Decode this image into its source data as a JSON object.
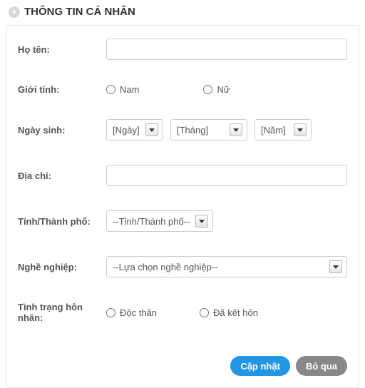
{
  "header": {
    "title": "THÔNG TIN CÁ NHÂN"
  },
  "form": {
    "fullname": {
      "label": "Họ tên:",
      "value": ""
    },
    "gender": {
      "label": "Giới tính:",
      "options": {
        "male": "Nam",
        "female": "Nữ"
      }
    },
    "dob": {
      "label": "Ngày sinh:",
      "day": "[Ngày]",
      "month": "[Tháng]",
      "year": "[Năm]"
    },
    "address": {
      "label": "Địa chỉ:",
      "value": ""
    },
    "province": {
      "label": "Tỉnh/Thành phố:",
      "selected": "--Tỉnh/Thành phố--"
    },
    "occupation": {
      "label": "Nghề nghiệp:",
      "selected": "--Lựa chọn nghề nghiệp--"
    },
    "marital": {
      "label": "Tình trạng hôn nhân:",
      "options": {
        "single": "Độc thân",
        "married": "Đã kết hôn"
      }
    }
  },
  "actions": {
    "update": "Cập nhật",
    "skip": "Bỏ qua"
  }
}
